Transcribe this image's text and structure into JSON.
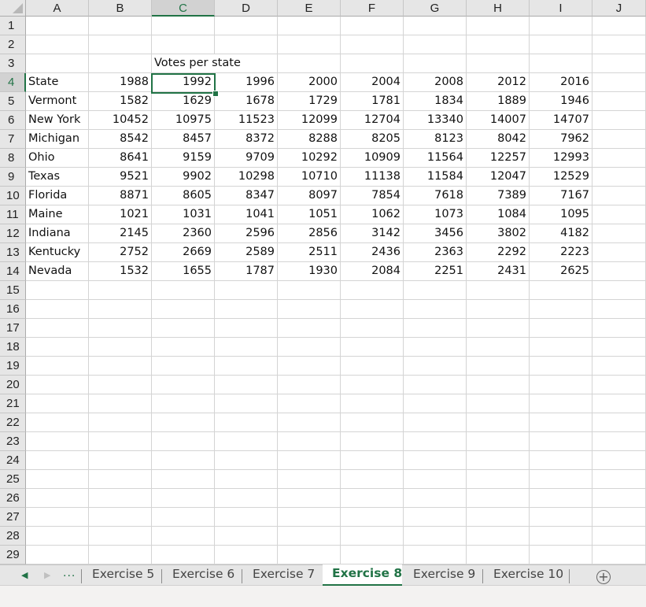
{
  "app": {
    "name": "Excel",
    "accent_color": "#217346"
  },
  "grid": {
    "columns": [
      "A",
      "B",
      "C",
      "D",
      "E",
      "F",
      "G",
      "H",
      "I",
      "J"
    ],
    "selected_column": "C",
    "row_numbers": [
      1,
      2,
      3,
      4,
      5,
      6,
      7,
      8,
      9,
      10,
      11,
      12,
      13,
      14,
      15,
      16,
      17,
      18,
      19,
      20,
      21,
      22,
      23,
      24,
      25,
      26,
      27,
      28,
      29
    ],
    "selected_row": 4,
    "active_cell": "C4",
    "title_cell": {
      "ref": "C3",
      "value": "Votes per state"
    },
    "header_row": {
      "label": "State",
      "years": [
        "1988",
        "1992",
        "1996",
        "2000",
        "2004",
        "2008",
        "2012",
        "2016"
      ]
    },
    "data_rows": [
      {
        "state": "Vermont",
        "values": [
          "1582",
          "1629",
          "1678",
          "1729",
          "1781",
          "1834",
          "1889",
          "1946"
        ]
      },
      {
        "state": "New York",
        "values": [
          "10452",
          "10975",
          "11523",
          "12099",
          "12704",
          "13340",
          "14007",
          "14707"
        ]
      },
      {
        "state": "Michigan",
        "values": [
          "8542",
          "8457",
          "8372",
          "8288",
          "8205",
          "8123",
          "8042",
          "7962"
        ]
      },
      {
        "state": "Ohio",
        "values": [
          "8641",
          "9159",
          "9709",
          "10292",
          "10909",
          "11564",
          "12257",
          "12993"
        ]
      },
      {
        "state": "Texas",
        "values": [
          "9521",
          "9902",
          "10298",
          "10710",
          "11138",
          "11584",
          "12047",
          "12529"
        ]
      },
      {
        "state": "Florida",
        "values": [
          "8871",
          "8605",
          "8347",
          "8097",
          "7854",
          "7618",
          "7389",
          "7167"
        ]
      },
      {
        "state": "Maine",
        "values": [
          "1021",
          "1031",
          "1041",
          "1051",
          "1062",
          "1073",
          "1084",
          "1095"
        ]
      },
      {
        "state": "Indiana",
        "values": [
          "2145",
          "2360",
          "2596",
          "2856",
          "3142",
          "3456",
          "3802",
          "4182"
        ]
      },
      {
        "state": "Kentucky",
        "values": [
          "2752",
          "2669",
          "2589",
          "2511",
          "2436",
          "2363",
          "2292",
          "2223"
        ]
      },
      {
        "state": "Nevada",
        "values": [
          "1532",
          "1655",
          "1787",
          "1930",
          "2084",
          "2251",
          "2431",
          "2625"
        ]
      }
    ]
  },
  "sheet_tabs": {
    "nav_prev_icon": "triangle-left",
    "nav_next_icon": "triangle-right",
    "more_label": "...",
    "tabs": [
      {
        "label": "Exercise 5",
        "active": false
      },
      {
        "label": "Exercise 6",
        "active": false
      },
      {
        "label": "Exercise 7",
        "active": false
      },
      {
        "label": "Exercise 8",
        "active": true
      },
      {
        "label": "Exercise 9",
        "active": false
      },
      {
        "label": "Exercise 10",
        "active": false
      }
    ],
    "add_sheet_label": "+"
  }
}
